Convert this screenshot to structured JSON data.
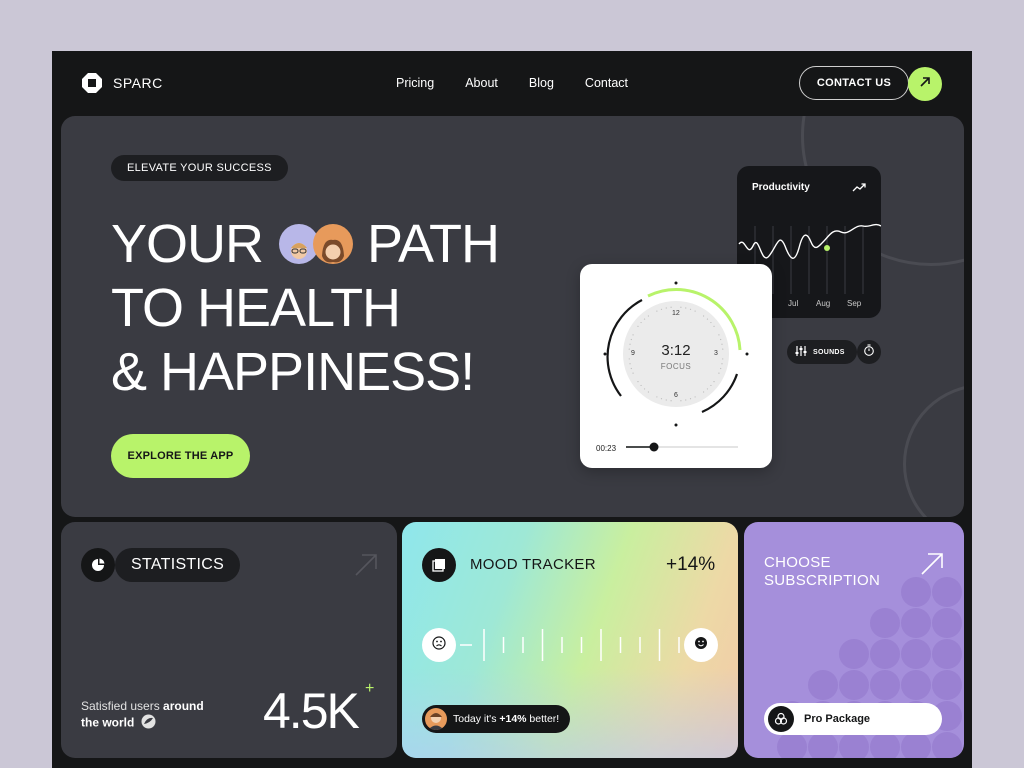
{
  "header": {
    "brand": "SPARC",
    "nav": [
      "Pricing",
      "About",
      "Blog",
      "Contact"
    ],
    "cta_label": "CONTACT US"
  },
  "hero": {
    "tag": "ELEVATE YOUR SUCCESS",
    "headline_line1_left": "YOUR",
    "headline_line1_right": "PATH",
    "headline_line2": "TO HEALTH",
    "headline_line3": "& HAPPINESS!",
    "explore_label": "EXPLORE THE APP"
  },
  "productivity": {
    "title": "Productivity",
    "months": [
      "Jul",
      "Aug",
      "Sep"
    ]
  },
  "controls": {
    "sounds_label": "SOUNDS"
  },
  "timer": {
    "time": "3:12",
    "label": "FOCUS",
    "numerals": [
      "12",
      "3",
      "6",
      "9"
    ],
    "elapsed": "00:23",
    "playback_progress": 0.25
  },
  "statistics": {
    "label": "STATISTICS",
    "desc_part1": "Satisfied users ",
    "desc_bold1": "around",
    "desc_bold2": "the world",
    "value": "4.5K",
    "plus": "+"
  },
  "mood": {
    "title": "MOOD TRACKER",
    "delta": "+14%",
    "bubble_prefix": "Today it's ",
    "bubble_bold": "+14%",
    "bubble_suffix": " better!"
  },
  "subscription": {
    "title_line1": "CHOOSE",
    "title_line2": "SUBSCRIPTION",
    "package": "Pro Package"
  },
  "colors": {
    "accent": "#b8f36a",
    "background": "#151617",
    "card": "#3a3b42",
    "subscription": "#a58fdb"
  }
}
